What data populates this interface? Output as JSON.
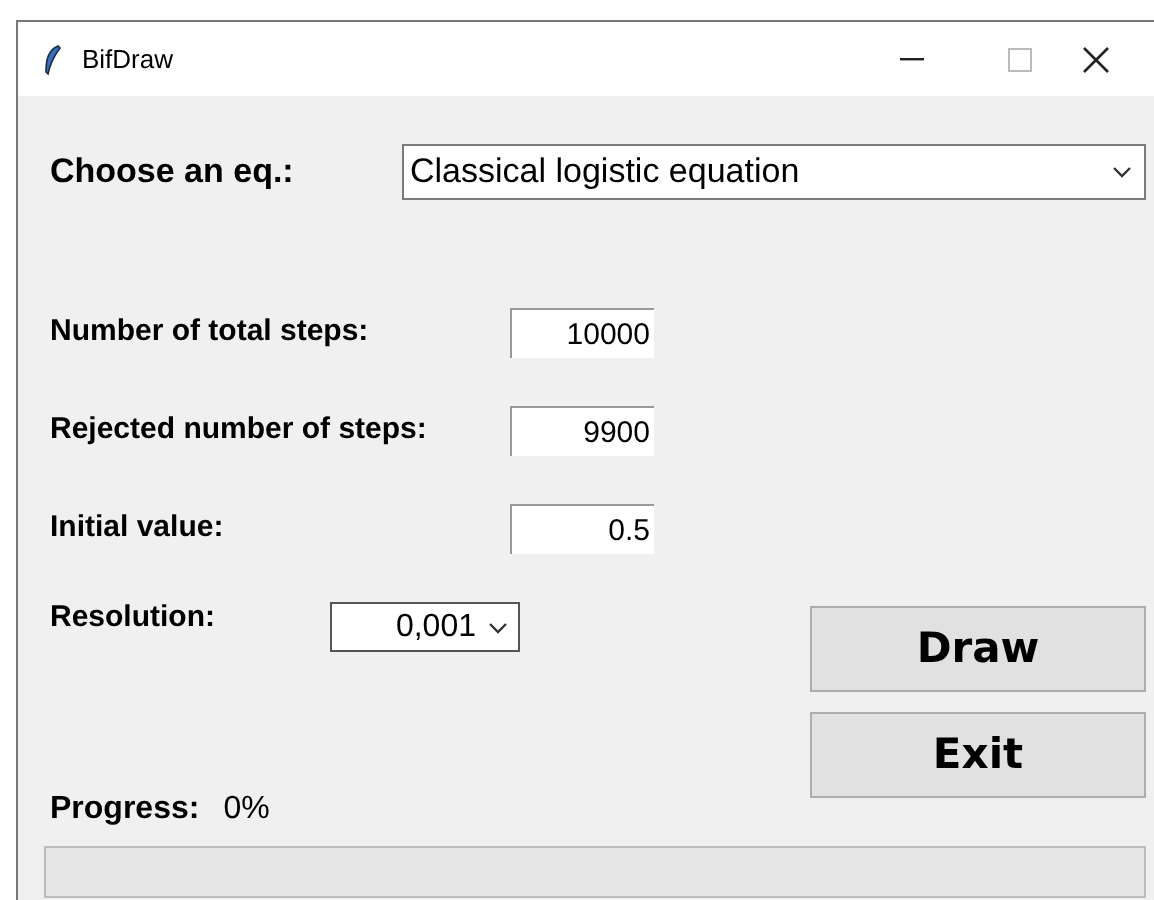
{
  "window": {
    "title": "BifDraw"
  },
  "equation": {
    "label": "Choose an eq.:",
    "value": "Classical logistic equation"
  },
  "fields": [
    {
      "label": "Number of total steps:",
      "value": "10000"
    },
    {
      "label": "Rejected number of steps:",
      "value": "9900"
    },
    {
      "label": "Initial value:",
      "value": "0.5"
    }
  ],
  "resolution": {
    "label": "Resolution:",
    "value": "0,001"
  },
  "buttons": [
    "Draw",
    "Exit"
  ],
  "progress": {
    "label": "Progress:",
    "reading": "0%",
    "level": 0
  }
}
